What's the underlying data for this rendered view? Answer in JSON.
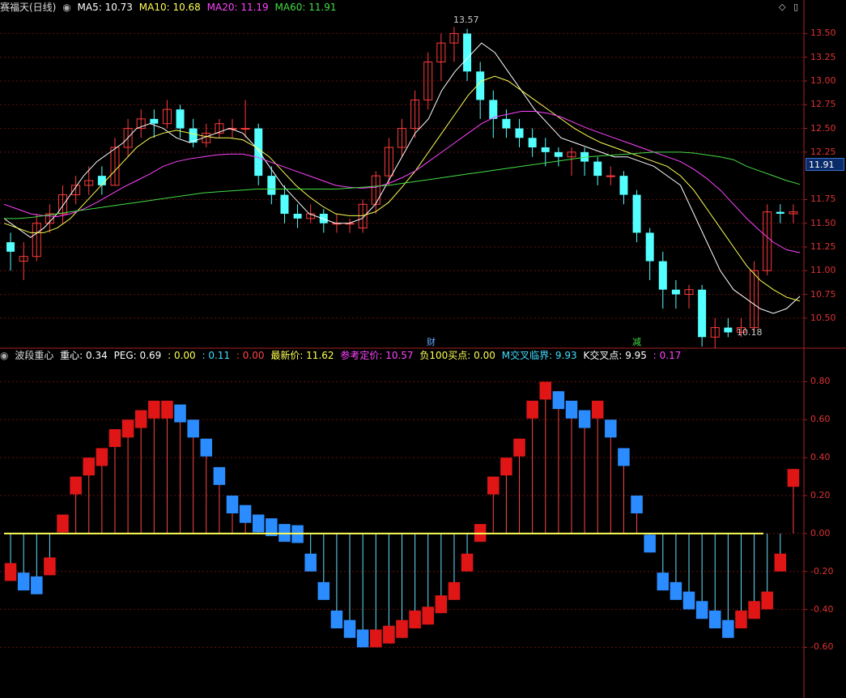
{
  "main_panel": {
    "stock_name": "赛福天(日线)",
    "indicators": [
      {
        "label": "MA5: 10.73",
        "color": "#ffffff"
      },
      {
        "label": "MA10: 10.68",
        "color": "#ffff55"
      },
      {
        "label": "MA20: 11.19",
        "color": "#ff44ff"
      },
      {
        "label": "MA60: 11.91",
        "color": "#44dd44"
      }
    ],
    "y_ticks": [
      "13.50",
      "13.25",
      "13.00",
      "12.75",
      "12.50",
      "12.25",
      "11.75",
      "11.50",
      "11.25",
      "11.00",
      "10.75",
      "10.50"
    ],
    "current_price_label": "11.91",
    "high_annotation": "13.57",
    "low_annotation": "10.18",
    "event_markers": [
      {
        "label": "财",
        "color": "#66aaff"
      },
      {
        "label": "减",
        "color": "#44dd44"
      }
    ]
  },
  "sub_panel": {
    "indicator_name": "波段重心",
    "values": [
      {
        "label": "重心: 0.34",
        "color": "#ffffff"
      },
      {
        "label": "PEG: 0.69",
        "color": "#ffffff"
      },
      {
        "label": ": 0.00",
        "color": "#ffff55"
      },
      {
        "label": ": 0.11",
        "color": "#44ddff"
      },
      {
        "label": ": 0.00",
        "color": "#ff4444"
      },
      {
        "label": "最新价: 11.62",
        "color": "#ffff55"
      },
      {
        "label": "参考定价: 10.57",
        "color": "#ff44ff"
      },
      {
        "label": "负100买点: 0.00",
        "color": "#ffff55"
      },
      {
        "label": "M交叉临界: 9.93",
        "color": "#44ddff"
      },
      {
        "label": "K交叉点: 9.95",
        "color": "#ffffff"
      },
      {
        "label": ": 0.17",
        "color": "#ff44ff"
      }
    ],
    "y_ticks": [
      "0.80",
      "0.60",
      "0.40",
      "0.20",
      "0.00",
      "-0.20",
      "-0.40",
      "-0.60"
    ]
  },
  "chart_data": [
    {
      "type": "candlestick",
      "title": "赛福天(日线)",
      "ylim": [
        10.2,
        13.7
      ],
      "series": [
        {
          "name": "MA5",
          "values": [
            11.55,
            11.45,
            11.35,
            11.45,
            11.6,
            11.8,
            12.0,
            12.15,
            12.25,
            12.35,
            12.5,
            12.55,
            12.5,
            12.4,
            12.35,
            12.4,
            12.45,
            12.5,
            12.45,
            12.3,
            12.1,
            11.9,
            11.75,
            11.6,
            11.55,
            11.5,
            11.5,
            11.55,
            11.7,
            11.95,
            12.2,
            12.45,
            12.6,
            12.9,
            13.1,
            13.25,
            13.4,
            13.3,
            13.1,
            12.9,
            12.7,
            12.55,
            12.4,
            12.35,
            12.3,
            12.25,
            12.2,
            12.2,
            12.15,
            12.1,
            12.0,
            11.9,
            11.6,
            11.3,
            11.0,
            10.8,
            10.7,
            10.6,
            10.55,
            10.6,
            10.73
          ]
        },
        {
          "name": "MA10",
          "values": [
            11.5,
            11.45,
            11.4,
            11.4,
            11.45,
            11.55,
            11.7,
            11.85,
            12.0,
            12.15,
            12.3,
            12.4,
            12.45,
            12.48,
            12.45,
            12.42,
            12.4,
            12.4,
            12.38,
            12.3,
            12.2,
            12.05,
            11.9,
            11.78,
            11.68,
            11.6,
            11.58,
            11.58,
            11.62,
            11.72,
            11.88,
            12.05,
            12.25,
            12.45,
            12.65,
            12.85,
            13.0,
            13.05,
            13.0,
            12.9,
            12.8,
            12.7,
            12.6,
            12.5,
            12.42,
            12.35,
            12.3,
            12.25,
            12.2,
            12.15,
            12.1,
            12.0,
            11.85,
            11.65,
            11.45,
            11.25,
            11.05,
            10.9,
            10.8,
            10.72,
            10.68
          ]
        },
        {
          "name": "MA20",
          "values": [
            11.7,
            11.65,
            11.6,
            11.58,
            11.57,
            11.6,
            11.65,
            11.72,
            11.8,
            11.88,
            11.95,
            12.02,
            12.1,
            12.15,
            12.18,
            12.2,
            12.22,
            12.23,
            12.23,
            12.2,
            12.15,
            12.1,
            12.05,
            12.0,
            11.95,
            11.9,
            11.88,
            11.87,
            11.88,
            11.92,
            11.98,
            12.05,
            12.15,
            12.25,
            12.35,
            12.45,
            12.55,
            12.62,
            12.65,
            12.68,
            12.68,
            12.66,
            12.62,
            12.56,
            12.5,
            12.45,
            12.4,
            12.35,
            12.3,
            12.25,
            12.2,
            12.15,
            12.07,
            11.97,
            11.85,
            11.7,
            11.55,
            11.42,
            11.3,
            11.22,
            11.19
          ]
        },
        {
          "name": "MA60",
          "values": [
            11.55,
            11.55,
            11.56,
            11.58,
            11.6,
            11.62,
            11.64,
            11.66,
            11.68,
            11.7,
            11.72,
            11.74,
            11.76,
            11.78,
            11.8,
            11.82,
            11.83,
            11.84,
            11.85,
            11.86,
            11.86,
            11.86,
            11.86,
            11.86,
            11.86,
            11.86,
            11.87,
            11.88,
            11.89,
            11.9,
            11.92,
            11.94,
            11.96,
            11.98,
            12.0,
            12.02,
            12.04,
            12.06,
            12.08,
            12.1,
            12.12,
            12.14,
            12.16,
            12.18,
            12.2,
            12.21,
            12.22,
            12.23,
            12.24,
            12.25,
            12.25,
            12.25,
            12.24,
            12.22,
            12.2,
            12.17,
            12.1,
            12.05,
            12.0,
            11.95,
            11.91
          ]
        }
      ],
      "candles": [
        [
          11.3,
          11.2,
          11.4,
          11.0
        ],
        [
          11.1,
          11.15,
          11.3,
          10.9
        ],
        [
          11.15,
          11.5,
          11.6,
          11.1
        ],
        [
          11.5,
          11.6,
          11.7,
          11.4
        ],
        [
          11.6,
          11.8,
          11.9,
          11.5
        ],
        [
          11.8,
          11.9,
          12.0,
          11.7
        ],
        [
          11.9,
          11.95,
          12.1,
          11.8
        ],
        [
          12.0,
          11.9,
          12.1,
          11.8
        ],
        [
          11.9,
          12.3,
          12.4,
          11.9
        ],
        [
          12.3,
          12.5,
          12.6,
          12.2
        ],
        [
          12.5,
          12.6,
          12.7,
          12.4
        ],
        [
          12.6,
          12.55,
          12.7,
          12.4
        ],
        [
          12.55,
          12.7,
          12.8,
          12.5
        ],
        [
          12.7,
          12.5,
          12.75,
          12.4
        ],
        [
          12.5,
          12.35,
          12.6,
          12.3
        ],
        [
          12.35,
          12.45,
          12.55,
          12.3
        ],
        [
          12.45,
          12.55,
          12.6,
          12.4
        ],
        [
          12.5,
          12.5,
          12.6,
          12.4
        ],
        [
          12.5,
          12.5,
          12.8,
          12.4
        ],
        [
          12.5,
          12.0,
          12.55,
          11.9
        ],
        [
          12.0,
          11.8,
          12.1,
          11.7
        ],
        [
          11.8,
          11.6,
          11.9,
          11.5
        ],
        [
          11.6,
          11.55,
          11.7,
          11.45
        ],
        [
          11.55,
          11.6,
          11.7,
          11.5
        ],
        [
          11.6,
          11.5,
          11.65,
          11.4
        ],
        [
          11.5,
          11.5,
          11.6,
          11.4
        ],
        [
          11.5,
          11.5,
          11.55,
          11.4
        ],
        [
          11.45,
          11.7,
          11.75,
          11.4
        ],
        [
          11.7,
          12.0,
          12.05,
          11.6
        ],
        [
          12.0,
          12.3,
          12.4,
          11.9
        ],
        [
          12.3,
          12.5,
          12.6,
          12.2
        ],
        [
          12.5,
          12.8,
          12.9,
          12.4
        ],
        [
          12.8,
          13.2,
          13.3,
          12.7
        ],
        [
          13.2,
          13.4,
          13.5,
          13.0
        ],
        [
          13.4,
          13.5,
          13.57,
          13.2
        ],
        [
          13.5,
          13.1,
          13.55,
          13.0
        ],
        [
          13.1,
          12.8,
          13.2,
          12.6
        ],
        [
          12.8,
          12.6,
          12.9,
          12.4
        ],
        [
          12.6,
          12.5,
          12.7,
          12.4
        ],
        [
          12.5,
          12.4,
          12.6,
          12.3
        ],
        [
          12.4,
          12.3,
          12.5,
          12.2
        ],
        [
          12.3,
          12.25,
          12.4,
          12.1
        ],
        [
          12.25,
          12.2,
          12.3,
          12.1
        ],
        [
          12.2,
          12.25,
          12.3,
          12.0
        ],
        [
          12.25,
          12.15,
          12.3,
          12.0
        ],
        [
          12.15,
          12.0,
          12.2,
          11.9
        ],
        [
          12.0,
          12.0,
          12.1,
          11.9
        ],
        [
          12.0,
          11.8,
          12.05,
          11.7
        ],
        [
          11.8,
          11.4,
          11.85,
          11.3
        ],
        [
          11.4,
          11.1,
          11.45,
          10.9
        ],
        [
          11.1,
          10.8,
          11.2,
          10.6
        ],
        [
          10.8,
          10.75,
          10.9,
          10.6
        ],
        [
          10.75,
          10.8,
          10.85,
          10.6
        ],
        [
          10.8,
          10.3,
          10.85,
          10.2
        ],
        [
          10.3,
          10.4,
          10.5,
          10.18
        ],
        [
          10.4,
          10.35,
          10.5,
          10.3
        ],
        [
          10.35,
          10.4,
          10.5,
          10.3
        ],
        [
          10.4,
          11.0,
          11.1,
          10.35
        ],
        [
          11.0,
          11.62,
          11.7,
          10.95
        ],
        [
          11.62,
          11.6,
          11.7,
          11.5
        ],
        [
          11.6,
          11.62,
          11.7,
          11.5
        ]
      ]
    },
    {
      "type": "bar",
      "title": "波段重心",
      "ylim": [
        -0.85,
        0.9
      ],
      "values": [
        -0.25,
        -0.3,
        -0.32,
        -0.22,
        0.1,
        0.3,
        0.4,
        0.45,
        0.55,
        0.6,
        0.65,
        0.7,
        0.7,
        0.68,
        0.6,
        0.5,
        0.35,
        0.2,
        0.15,
        0.1,
        0.08,
        0.05,
        -0.05,
        -0.2,
        -0.35,
        -0.5,
        -0.55,
        -0.6,
        -0.6,
        -0.58,
        -0.55,
        -0.5,
        -0.48,
        -0.42,
        -0.35,
        -0.2,
        0.05,
        0.3,
        0.4,
        0.5,
        0.7,
        0.8,
        0.75,
        0.7,
        0.65,
        0.7,
        0.6,
        0.45,
        0.2,
        -0.1,
        -0.3,
        -0.35,
        -0.4,
        -0.45,
        -0.5,
        -0.55,
        -0.5,
        -0.45,
        -0.4,
        -0.2,
        0.34
      ]
    }
  ]
}
